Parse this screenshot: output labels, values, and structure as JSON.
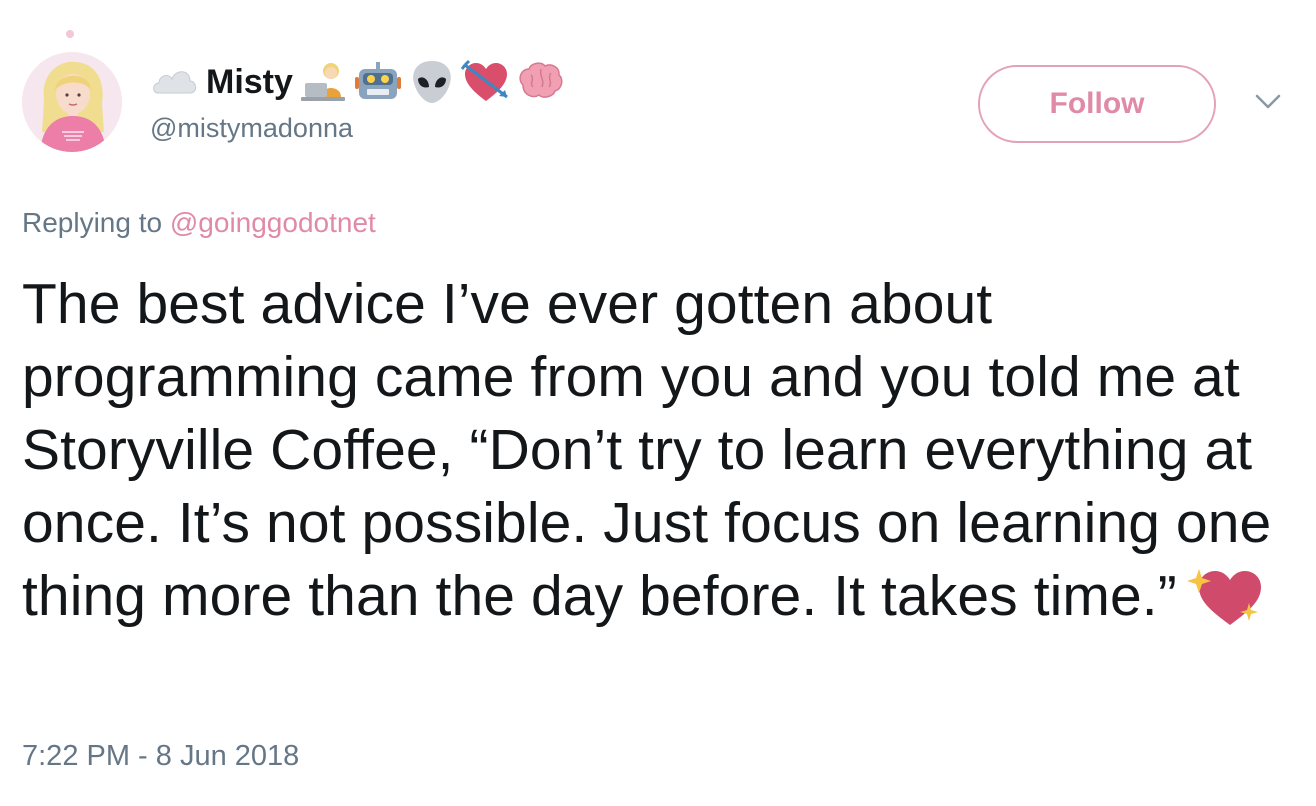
{
  "user": {
    "display_name": "Misty",
    "handle": "@mistymadonna",
    "avatar_icon": "avatar-girl-pink-shirt",
    "name_emojis": [
      "cloud",
      "woman-technologist",
      "robot",
      "alien",
      "heart-with-arrow",
      "brain"
    ]
  },
  "actions": {
    "follow_label": "Follow",
    "menu_icon": "chevron-down-icon"
  },
  "reply": {
    "prefix": "Replying to",
    "mention": "@goinggodotnet"
  },
  "tweet": {
    "text": "The best advice I’ve ever gotten about programming came from you and you told me at Storyville Coffee, “Don’t try to learn everything at once. It’s not possible. Just focus on learning one thing more than the day before. It takes time.”",
    "trailing_emoji": "sparkling-heart"
  },
  "meta": {
    "timestamp": "7:22 PM - 8 Jun 2018"
  },
  "colors": {
    "accent": "#e08aa8",
    "follow_border": "#e3a2b9",
    "text": "#14171a",
    "secondary": "#657786"
  }
}
